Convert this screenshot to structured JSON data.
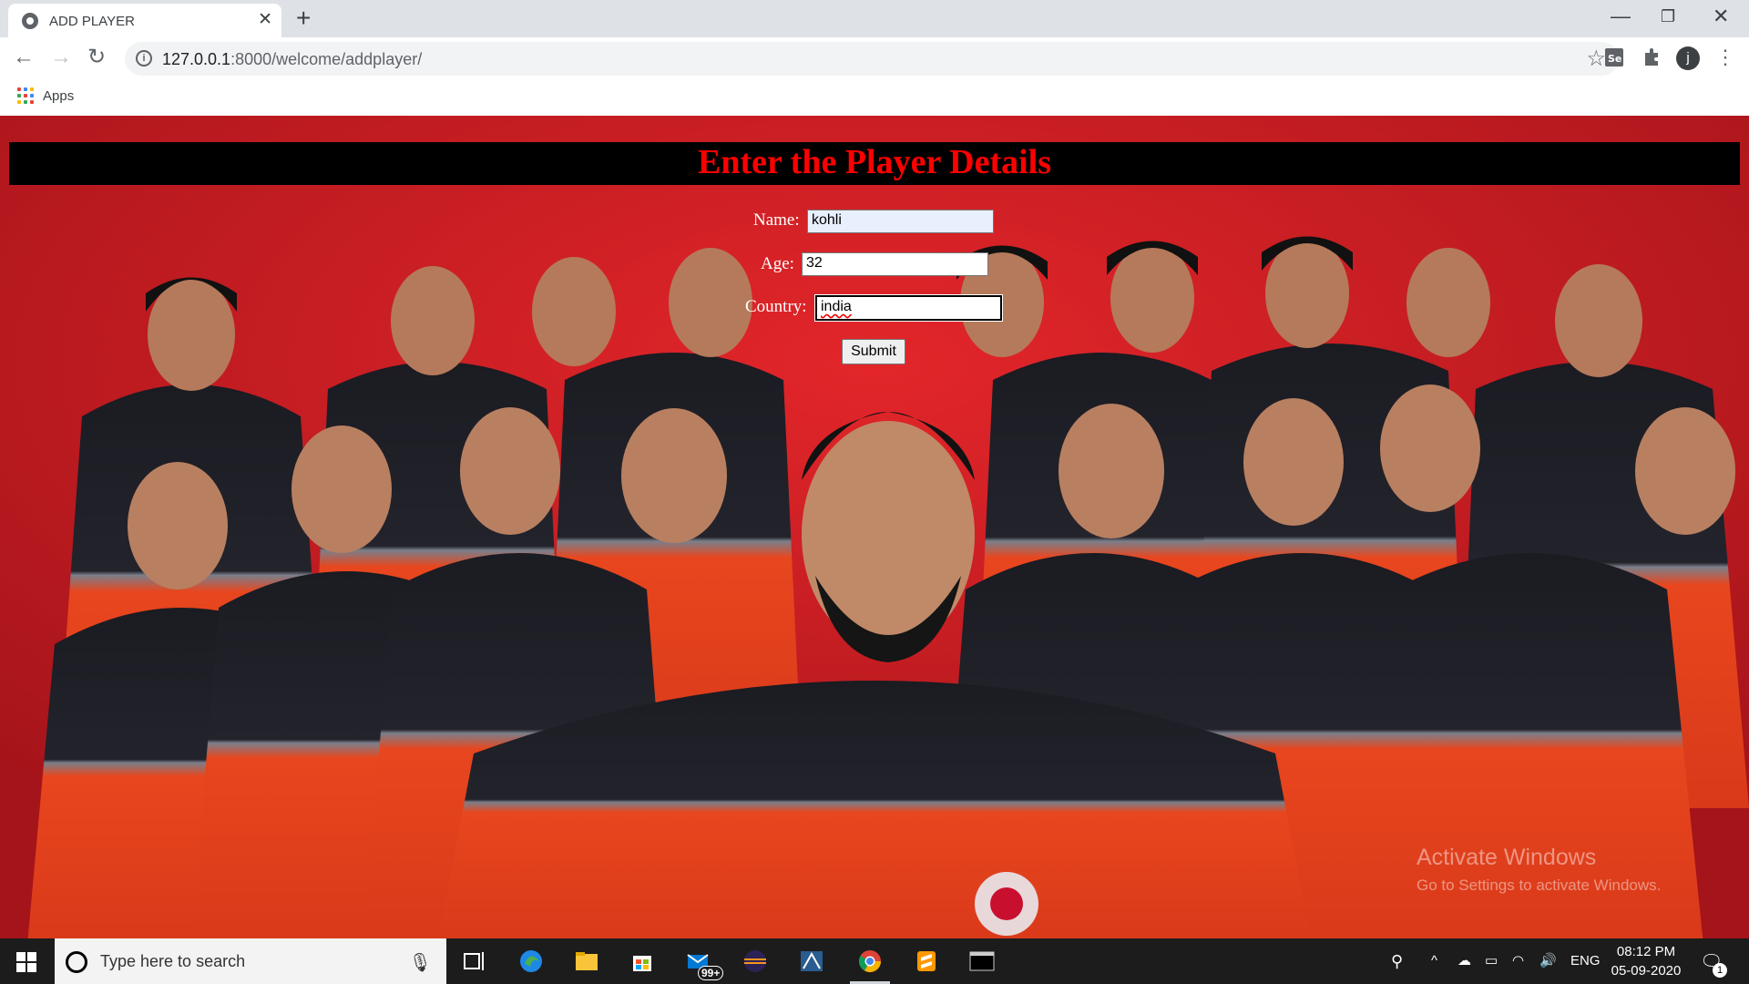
{
  "browser": {
    "tab_title": "ADD PLAYER",
    "url_host": "127.0.0.1",
    "url_path": ":8000/welcome/addplayer/",
    "bookmarks_apps_label": "Apps",
    "profile_initial": "j"
  },
  "form": {
    "heading": "Enter the Player Details",
    "name_label": "Name:",
    "name_value": "kohli",
    "age_label": "Age:",
    "age_value": "32",
    "country_label": "Country:",
    "country_value": "india",
    "submit_label": "Submit"
  },
  "watermark": {
    "line1": "Activate Windows",
    "line2": "Go to Settings to activate Windows."
  },
  "taskbar": {
    "search_placeholder": "Type here to search",
    "mail_badge": "99+",
    "language": "ENG",
    "time": "08:12 PM",
    "date": "05-09-2020",
    "notification_count": "1"
  },
  "colors": {
    "page_red": "#d11f22",
    "heading_red": "#ff0000",
    "heading_bar": "#000000",
    "jersey_orange": "#e8461e",
    "jersey_black": "#1b1b22"
  }
}
